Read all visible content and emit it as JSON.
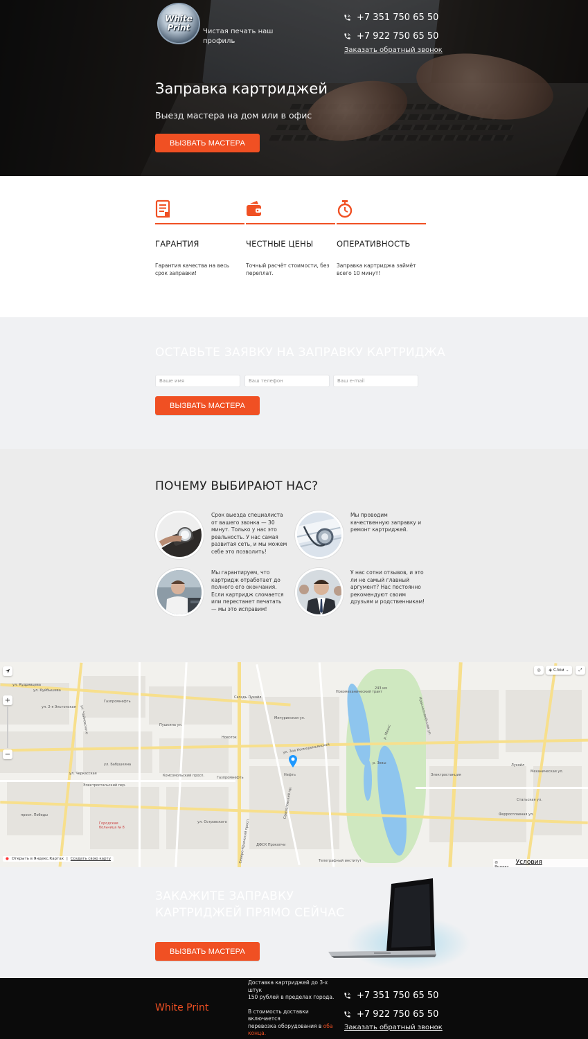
{
  "header": {
    "logo_line1": "White",
    "logo_line2": "Print",
    "tagline": "Чистая печать наш профиль",
    "phone1": "+7 351 750 65 50",
    "phone2": "+7 922 750 65 50",
    "callback_link": "Заказать обратный звонок"
  },
  "hero": {
    "title": "Заправка картриджей",
    "subtitle": "Выезд мастера на дом или в офис",
    "button": "ВЫЗВАТЬ МАСТЕРА"
  },
  "features": [
    {
      "icon": "document-icon",
      "title": "ГАРАНТИЯ",
      "text": "Гарантия качества на весь срок заправки!"
    },
    {
      "icon": "wallet-icon",
      "title": "ЧЕСТНЫЕ ЦЕНЫ",
      "text": "Точный расчёт стоимости, без переплат."
    },
    {
      "icon": "stopwatch-icon",
      "title": "ОПЕРАТИВНОСТЬ",
      "text": "Заправка картриджа займёт всего 10 минут!"
    }
  ],
  "form": {
    "title": "ОСТАВЬТЕ ЗАЯВКУ НА ЗАПРАВКУ КАРТРИДЖА",
    "name_placeholder": "Ваше имя",
    "phone_placeholder": "Ваш телефон",
    "email_placeholder": "Ваш e-mail",
    "button": "ВЫЗВАТЬ МАСТЕРА"
  },
  "why": {
    "title": "ПОЧЕМУ ВЫБИРАЮТ НАС?",
    "items": [
      {
        "text": "Срок выезда специалиста от вашего звонка — 30 минут. Только у нас это реальность. У нас самая развитая сеть, и мы можем себе это позволить!"
      },
      {
        "text": "Мы проводим качественную заправку и ремонт картриджей."
      },
      {
        "text": "Мы гарантируем, что картридж отработает до полного его окончания. Если картридж сломается или перестанет печатать — мы это исправим!"
      },
      {
        "text": "У нас сотни отзывов, и это ли не самый главный аргумент? Нас постоянно рекомендуют своим друзьям и родственникам!"
      }
    ]
  },
  "map": {
    "layers_label": "Слои",
    "open_link": "Открыть в Яндекс.Картах",
    "create_link": "Создать свою карту",
    "yandex": "© Яндекс",
    "terms": "Условия использования",
    "streets": [
      "ул. Кудрявцева",
      "ул. Куйбышева",
      "Газпромнефть",
      "ул. 2-я Эльтонская",
      "ул. Чайковского",
      "Сагадь Лукойл",
      "Комсомольский просп.",
      "Электростальский пер.",
      "ул. Островского",
      "Северо-Крымский просп.",
      "просп. Победы",
      "Городская больница № 8",
      "ДФСК Прокопчи",
      "Телеграфный институт",
      "р. Миасс",
      "р. Зевы",
      "Механическая ул.",
      "Стальская ул.",
      "Ферросплавная ул.",
      "Электростанция",
      "Новомеханический тракт",
      "243 км",
      "Лукойл",
      "Газпромнефть",
      "Нефть",
      "Новоток",
      "ул. Зои Космодемьянской",
      "Свердловский пр.",
      "ул. Бабушкина",
      "ул. Черкасская",
      "Краснознамённая ул.",
      "Пушкина ул.",
      "Мичуринская ул."
    ]
  },
  "cta": {
    "title": "ЗАКАЖИТЕ ЗАПРАВКУ КАРТРИДЖЕЙ ПРЯМО СЕЙЧАС",
    "button": "ВЫЗВАТЬ МАСТЕРА"
  },
  "footer": {
    "brand": "White Print",
    "delivery_line1": "Доставка картриджей до 3-х штук",
    "delivery_line2": "150 рублей в пределах города.",
    "delivery_line3": "В стоимость доставки включается",
    "delivery_line4": "перевозка оборудования в",
    "delivery_highlight": "оба конца.",
    "phone1": "+7 351 750 65 50",
    "phone2": "+7 922 750 65 50",
    "callback_link": "Заказать обратный звонок"
  },
  "colors": {
    "accent": "#f05023",
    "footer_bg": "#0b0b0b",
    "section_bg": "#f0f1f3"
  }
}
